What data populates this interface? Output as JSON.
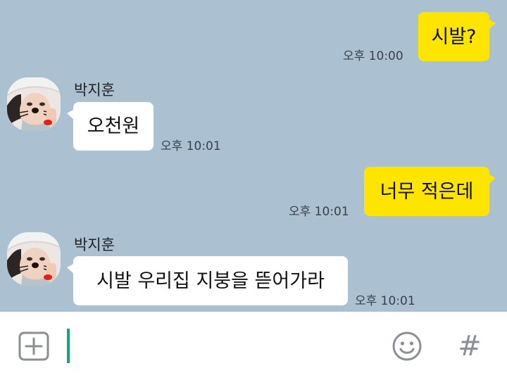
{
  "messages": [
    {
      "sender": "",
      "text": "시발?",
      "time": "오후 10:00"
    },
    {
      "sender": "박지훈",
      "text": "오천원",
      "time": "오후 10:01"
    },
    {
      "sender": "",
      "text": "너무 적은데",
      "time": "오후 10:01"
    },
    {
      "sender": "박지훈",
      "text": "시발 우리집 지붕을 뜯어가라",
      "time": "오후 10:01"
    }
  ],
  "input": {
    "value": ""
  },
  "icons": {
    "attach": "plus-square-icon",
    "emoticon": "smiley-icon",
    "hashtag": "hash-icon",
    "hashtag_glyph": "#"
  },
  "colors": {
    "background": "#abc1d1",
    "my_bubble": "#fee500",
    "their_bubble": "#ffffff",
    "cursor": "#18a086"
  }
}
